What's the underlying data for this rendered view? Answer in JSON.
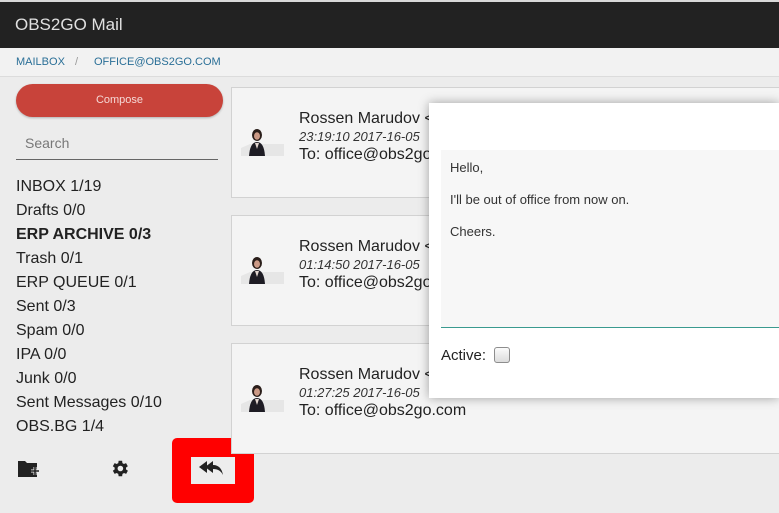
{
  "app": {
    "title": "OBS2GO Mail"
  },
  "breadcrumb": {
    "items": [
      "MAILBOX",
      "OFFICE@OBS2GO.COM"
    ],
    "separator": "/"
  },
  "sidebar": {
    "compose_label": "Compose",
    "search_placeholder": "Search",
    "folders": [
      {
        "label": "INBOX 1/19",
        "bold": false
      },
      {
        "label": "Drafts 0/0",
        "bold": false
      },
      {
        "label": "ERP ARCHIVE 0/3",
        "bold": true
      },
      {
        "label": "Trash 0/1",
        "bold": false
      },
      {
        "label": "ERP QUEUE 0/1",
        "bold": false
      },
      {
        "label": "Sent 0/3",
        "bold": false
      },
      {
        "label": "Spam 0/0",
        "bold": false
      },
      {
        "label": "IPA 0/0",
        "bold": false
      },
      {
        "label": "Junk 0/0",
        "bold": false
      },
      {
        "label": "Sent Messages 0/10",
        "bold": false
      },
      {
        "label": "OBS.BG 1/4",
        "bold": false
      }
    ],
    "tools": [
      "new-folder-icon",
      "gear-icon",
      "reply-icon"
    ]
  },
  "mails": [
    {
      "sender": "Rossen Marudov <",
      "time": "23:19:10 2017-16-05",
      "to": "To: office@obs2go.com"
    },
    {
      "sender": "Rossen Marudov <",
      "time": "01:14:50 2017-16-05",
      "to": "To: office@obs2go.com"
    },
    {
      "sender": "Rossen Marudov <",
      "time": "01:27:25 2017-16-05",
      "to": "To: office@obs2go.com"
    }
  ],
  "autoreply": {
    "message_lines": [
      "Hello,",
      "I'll be out of office from now on.",
      "Cheers."
    ],
    "active_label": "Active:",
    "active_checked": false
  },
  "colors": {
    "topbar": "#222222",
    "compose": "#c8433a",
    "link": "#2a6f97",
    "highlight": "#ff0000",
    "accent": "#3a9a8f"
  }
}
